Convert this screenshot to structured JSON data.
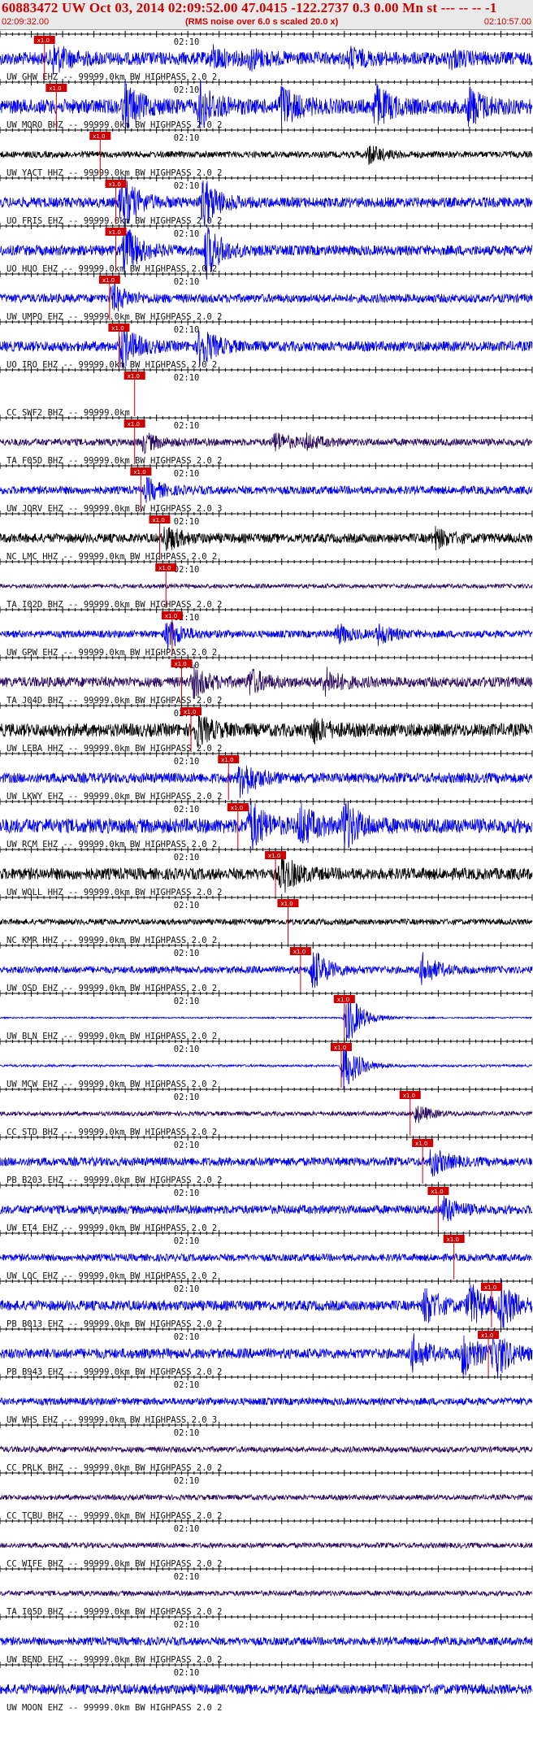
{
  "header": {
    "title": "60883472 UW Oct 03, 2014 02:09:52.00   47.0415 -122.2737  0.3 0.00 Mn st --- -- --  -1",
    "start_time": "02:09:32.00",
    "note": "(RMS noise over 6.0 s scaled 20.0 x)",
    "end_time": "02:10:57.00"
  },
  "colors": {
    "title": "#cc0000",
    "blue": "#0000ee",
    "purple": "#2a0a5e",
    "black": "#000000",
    "pick": "#cc0000",
    "axis": "#000000"
  },
  "chart_data": {
    "type": "seismogram-record-section",
    "time_range": [
      "02:09:32.00",
      "02:10:57.00"
    ],
    "minute_mark": "02:10",
    "pick_tag": "x1.0",
    "traces": [
      {
        "label": "UW GHW EHZ -- 99999.0km BW  HIGHPASS  2.0  2",
        "color": "blue",
        "amp": 0.45,
        "pick": 7.1,
        "bursts": [
          [
            8.5,
            0.9
          ],
          [
            34,
            0.6
          ],
          [
            40,
            0.5
          ],
          [
            56,
            0.5
          ],
          [
            72,
            0.45
          ]
        ]
      },
      {
        "label": "UW MORO BHZ -- 99999.0km BW  HIGHPASS  2.0  2",
        "color": "blue",
        "amp": 0.5,
        "pick": 9.0,
        "bursts": [
          [
            20,
            1.4
          ],
          [
            32,
            1.4
          ],
          [
            45,
            1.3
          ],
          [
            60,
            1.3
          ],
          [
            75,
            1.2
          ]
        ]
      },
      {
        "label": "UW YACT HHZ -- 99999.0km BW  HIGHPASS  2.0  2",
        "color": "black",
        "amp": 0.22,
        "pick": 16.0,
        "bursts": [
          [
            59,
            0.6
          ]
        ]
      },
      {
        "label": "UO FRIS EHZ -- 99999.0km BW  HIGHPASS  2.0  2",
        "color": "blue",
        "amp": 0.35,
        "pick": 18.5,
        "bursts": [
          [
            19.5,
            1.8
          ],
          [
            32.5,
            1.6
          ]
        ]
      },
      {
        "label": "UO HUO EHZ -- 99999.0km BW  HIGHPASS  2.0  2",
        "color": "blue",
        "amp": 0.35,
        "pick": 18.5,
        "bursts": [
          [
            20,
            1.6
          ],
          [
            33,
            1.7
          ]
        ]
      },
      {
        "label": "UW UMPQ EHZ -- 99999.0km BW  HIGHPASS  2.0  2",
        "color": "blue",
        "amp": 0.3,
        "pick": 17.5,
        "bursts": [
          [
            18,
            0.9
          ]
        ]
      },
      {
        "label": "UO IRO EHZ -- 99999.0km BW  HIGHPASS  2.0  2",
        "color": "blue",
        "amp": 0.35,
        "pick": 19.0,
        "bursts": [
          [
            19.5,
            1.4
          ],
          [
            32,
            1.3
          ]
        ]
      },
      {
        "label": "CC SWF2 BHZ -- 99999.0km",
        "color": "black",
        "amp": 0.0,
        "pick": 21.5,
        "bursts": []
      },
      {
        "label": "TA F05D BHZ -- 99999.0km BW  HIGHPASS  2.0  2",
        "color": "purple",
        "amp": 0.25,
        "pick": 21.5,
        "bursts": [
          [
            23,
            0.6
          ],
          [
            44,
            0.6
          ],
          [
            49,
            0.4
          ]
        ]
      },
      {
        "label": "UW JORV EHZ -- 99999.0km BW  HIGHPASS  2.0  3",
        "color": "blue",
        "amp": 0.28,
        "pick": 22.5,
        "bursts": [
          [
            23.5,
            0.7
          ]
        ]
      },
      {
        "label": "NC LMC HHZ -- 99999.0km BW  HIGHPASS  2.0  2",
        "color": "black",
        "amp": 0.32,
        "pick": 25.5,
        "bursts": [
          [
            26.5,
            0.8
          ],
          [
            69.5,
            0.6
          ]
        ]
      },
      {
        "label": "TA I02D BHZ -- 99999.0km BW  HIGHPASS  2.0  2",
        "color": "purple",
        "amp": 0.15,
        "pick": 26.5,
        "bursts": []
      },
      {
        "label": "UW GPW EHZ -- 99999.0km BW  HIGHPASS  2.0  2",
        "color": "blue",
        "amp": 0.25,
        "pick": 27.5,
        "bursts": [
          [
            26.8,
            1.0
          ],
          [
            54,
            0.6
          ],
          [
            60.5,
            0.6
          ]
        ]
      },
      {
        "label": "TA J04D BHZ -- 99999.0km BW  HIGHPASS  2.0  2",
        "color": "purple",
        "amp": 0.35,
        "pick": 29.0,
        "bursts": [
          [
            31,
            0.9
          ],
          [
            40,
            0.8
          ],
          [
            52,
            0.8
          ]
        ]
      },
      {
        "label": "UW LEBA HHZ -- 99999.0km BW  HIGHPASS  2.0  2",
        "color": "black",
        "amp": 0.45,
        "pick": 30.5,
        "bursts": [
          [
            31.5,
            0.9
          ],
          [
            50,
            0.7
          ]
        ]
      },
      {
        "label": "UW LKWY EHZ -- 99999.0km BW  HIGHPASS  2.0  2",
        "color": "blue",
        "amp": 0.35,
        "pick": 36.5,
        "bursts": [
          [
            38.5,
            1.3
          ]
        ]
      },
      {
        "label": "UW RCM EHZ -- 99999.0km BW  HIGHPASS  2.0  2",
        "color": "blue",
        "amp": 0.5,
        "pick": 38.0,
        "bursts": [
          [
            40,
            1.6
          ],
          [
            48,
            1.3
          ],
          [
            55,
            1.6
          ]
        ]
      },
      {
        "label": "UW WOLL HHZ -- 99999.0km BW  HIGHPASS  2.0  2",
        "color": "black",
        "amp": 0.4,
        "pick": 44.0,
        "bursts": [
          [
            45,
            1.2
          ]
        ]
      },
      {
        "label": "NC KMR HHZ -- 99999.0km BW  HIGHPASS  2.0  2",
        "color": "black",
        "amp": 0.2,
        "pick": 46.0,
        "bursts": []
      },
      {
        "label": "UW OSD EHZ -- 99999.0km BW  HIGHPASS  2.0  2",
        "color": "blue",
        "amp": 0.25,
        "pick": 48.0,
        "bursts": [
          [
            50,
            1.4
          ],
          [
            67.5,
            1.0
          ]
        ]
      },
      {
        "label": "UW BLN EHZ -- 99999.0km BW  HIGHPASS  2.0  2",
        "color": "blue",
        "amp": 0.05,
        "pick": 55.0,
        "bursts": [
          [
            55.5,
            1.9
          ]
        ]
      },
      {
        "label": "UW MCW EHZ -- 99999.0km BW  HIGHPASS  2.0  2",
        "color": "blue",
        "amp": 0.08,
        "pick": 54.5,
        "bursts": [
          [
            55,
            1.8
          ]
        ]
      },
      {
        "label": "CC STD BHZ -- 99999.0km BW  HIGHPASS  2.0  2",
        "color": "purple",
        "amp": 0.15,
        "pick": 65.5,
        "bursts": [
          [
            66.5,
            0.6
          ]
        ]
      },
      {
        "label": "PB B203 EHZ -- 99999.0km BW  HIGHPASS  2.0  2",
        "color": "blue",
        "amp": 0.3,
        "pick": 67.5,
        "bursts": [
          [
            69,
            0.9
          ]
        ]
      },
      {
        "label": "UW ET4 EHZ -- 99999.0km BW  HIGHPASS  2.0  2",
        "color": "blue",
        "amp": 0.3,
        "pick": 70.0,
        "bursts": [
          [
            71,
            0.8
          ]
        ]
      },
      {
        "label": "UW LOC EHZ -- 99999.0km BW  HIGHPASS  2.0  2",
        "color": "blue",
        "amp": 0.25,
        "pick": 72.5,
        "bursts": []
      },
      {
        "label": "PB B013 EHZ -- 99999.0km BW  HIGHPASS  2.0  2",
        "color": "blue",
        "amp": 0.35,
        "pick": 78.5,
        "bursts": [
          [
            68,
            1.2
          ],
          [
            75,
            1.4
          ],
          [
            80,
            1.5
          ]
        ]
      },
      {
        "label": "PB B943 EHZ -- 99999.0km BW  HIGHPASS  2.0  2",
        "color": "blue",
        "amp": 0.35,
        "pick": 78.0,
        "bursts": [
          [
            66,
            1.1
          ],
          [
            74,
            1.4
          ],
          [
            79,
            1.6
          ]
        ]
      },
      {
        "label": "UW WHS EHZ -- 99999.0km BW  HIGHPASS  2.0  3",
        "color": "blue",
        "amp": 0.25,
        "pick": null,
        "bursts": []
      },
      {
        "label": "CC PRLK BHZ -- 99999.0km BW  HIGHPASS  2.0  2",
        "color": "purple",
        "amp": 0.2,
        "pick": null,
        "bursts": []
      },
      {
        "label": "CC TCBU BHZ -- 99999.0km BW  HIGHPASS  2.0  2",
        "color": "purple",
        "amp": 0.18,
        "pick": null,
        "bursts": []
      },
      {
        "label": "CC WIFE BHZ -- 99999.0km BW  HIGHPASS  2.0  2",
        "color": "purple",
        "amp": 0.18,
        "pick": null,
        "bursts": []
      },
      {
        "label": "TA I05D BHZ -- 99999.0km BW  HIGHPASS  2.0  2",
        "color": "purple",
        "amp": 0.18,
        "pick": null,
        "bursts": []
      },
      {
        "label": "UW BEND EHZ -- 99999.0km BW  HIGHPASS  2.0  2",
        "color": "blue",
        "amp": 0.28,
        "pick": null,
        "bursts": []
      },
      {
        "label": "UW MOON EHZ -- 99999.0km BW  HIGHPASS  2.0  2",
        "color": "blue",
        "amp": 0.35,
        "pick": null,
        "bursts": []
      }
    ]
  }
}
